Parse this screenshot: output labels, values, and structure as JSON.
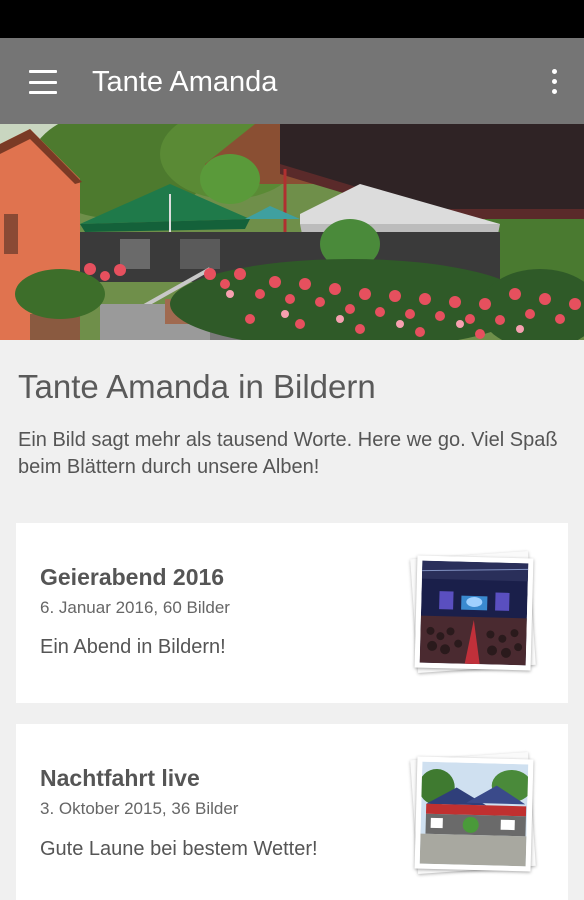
{
  "app_bar": {
    "title": "Tante Amanda",
    "menu_icon": "hamburger-menu-icon",
    "overflow_icon": "more-vert-icon"
  },
  "intro": {
    "title": "Tante Amanda in Bildern",
    "description": "Ein Bild sagt mehr als tausend Worte. Here we go. Viel Spaß beim Blättern durch unsere Alben!"
  },
  "albums": [
    {
      "title": "Geierabend 2016",
      "meta": "6. Januar 2016, 60 Bilder",
      "description": "Ein Abend in Bildern!"
    },
    {
      "title": "Nachtfahrt live",
      "meta": "3. Oktober 2015, 36 Bilder",
      "description": "Gute Laune bei bestem Wetter!"
    }
  ],
  "colors": {
    "app_bar": "#757575",
    "background": "#f0f0f0",
    "card": "#ffffff"
  }
}
